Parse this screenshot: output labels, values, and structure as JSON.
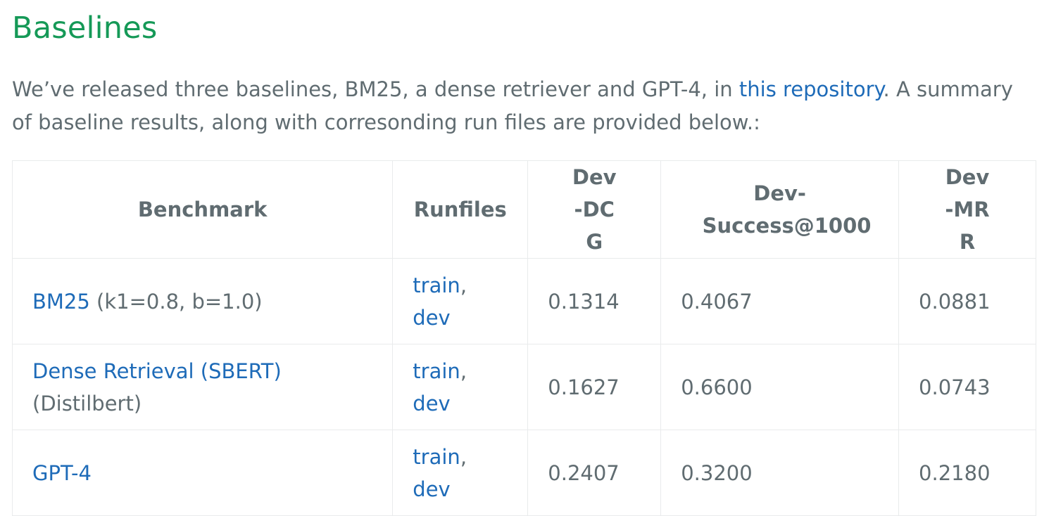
{
  "heading": "Baselines",
  "intro": {
    "before_link": "We’ve released three baselines, BM25, a dense retriever and GPT-4, in ",
    "link_text": "this repository",
    "after_link": ". A summary of baseline results, along with corresonding run files are provided below.:"
  },
  "table": {
    "headers": {
      "benchmark": "Benchmark",
      "runfiles": "Runfiles",
      "dcg": "Dev-DCG",
      "success": "Dev-Success@1000",
      "mrr": "Dev-MRR"
    },
    "rows": [
      {
        "benchmark_link": "BM25",
        "benchmark_note": " (k1=0.8, b=1.0)",
        "train": "train",
        "sep": ",",
        "dev": "dev",
        "dcg": "0.1314",
        "success": "0.4067",
        "mrr": "0.0881"
      },
      {
        "benchmark_link": "Dense Retrieval (SBERT)",
        "benchmark_note": "(Distilbert)",
        "train": "train",
        "sep": ",",
        "dev": "dev",
        "dcg": "0.1627",
        "success": "0.6600",
        "mrr": "0.0743"
      },
      {
        "benchmark_link": "GPT-4",
        "benchmark_note": "",
        "train": "train",
        "sep": ",",
        "dev": "dev",
        "dcg": "0.2407",
        "success": "0.3200",
        "mrr": "0.2180"
      }
    ]
  },
  "colors": {
    "heading": "#159957",
    "text": "#606c71",
    "link": "#1e6bb8",
    "border": "#e9ebec"
  }
}
